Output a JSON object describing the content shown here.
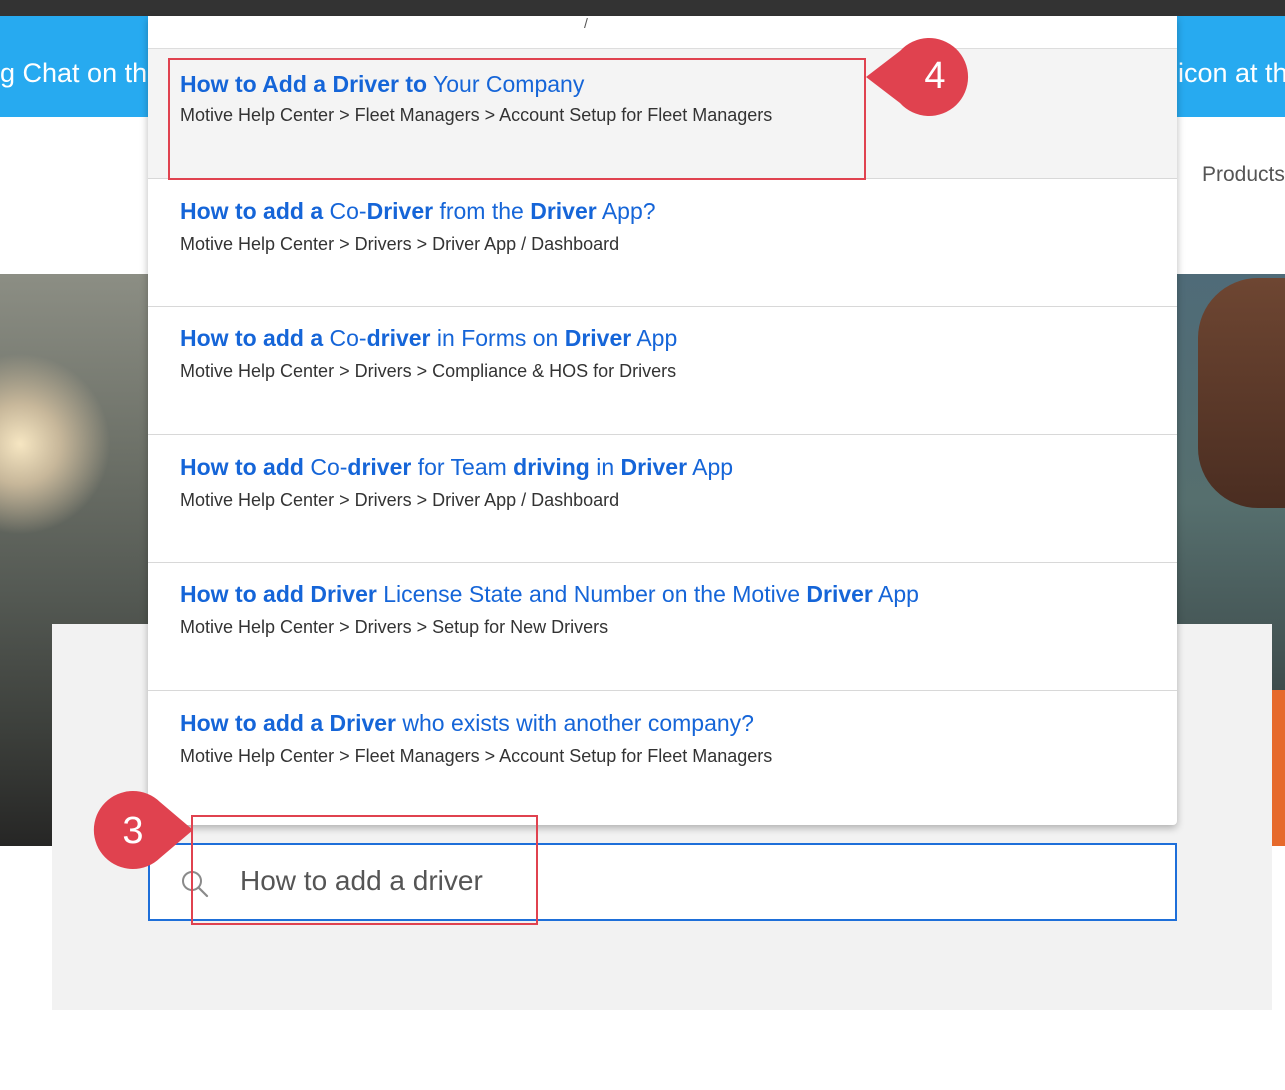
{
  "banner": {
    "left_text": "g Chat on the",
    "right_text": "icon at the"
  },
  "nav": {
    "products": "Products"
  },
  "dropdown": {
    "top_fragment": "/",
    "results": [
      {
        "title_parts": [
          {
            "t": "How to Add a Driver to",
            "b": true
          },
          {
            "t": " Your Company",
            "b": false
          }
        ],
        "path": "Motive Help Center > Fleet Managers > Account Setup for Fleet Managers"
      },
      {
        "title_parts": [
          {
            "t": "How to add a",
            "b": true
          },
          {
            "t": " Co-",
            "b": false
          },
          {
            "t": "Driver",
            "b": true
          },
          {
            "t": " from the ",
            "b": false
          },
          {
            "t": "Driver",
            "b": true
          },
          {
            "t": " App?",
            "b": false
          }
        ],
        "path": "Motive Help Center > Drivers > Driver App / Dashboard"
      },
      {
        "title_parts": [
          {
            "t": "How to add a",
            "b": true
          },
          {
            "t": " Co-",
            "b": false
          },
          {
            "t": "driver",
            "b": true
          },
          {
            "t": " in Forms on ",
            "b": false
          },
          {
            "t": "Driver",
            "b": true
          },
          {
            "t": " App",
            "b": false
          }
        ],
        "path": "Motive Help Center > Drivers > Compliance & HOS for Drivers"
      },
      {
        "title_parts": [
          {
            "t": "How to add",
            "b": true
          },
          {
            "t": " Co-",
            "b": false
          },
          {
            "t": "driver",
            "b": true
          },
          {
            "t": " for Team ",
            "b": false
          },
          {
            "t": "driving",
            "b": true
          },
          {
            "t": " in ",
            "b": false
          },
          {
            "t": "Driver",
            "b": true
          },
          {
            "t": " App",
            "b": false
          }
        ],
        "path": "Motive Help Center > Drivers > Driver App / Dashboard"
      },
      {
        "title_parts": [
          {
            "t": "How to add",
            "b": true
          },
          {
            "t": " ",
            "b": false
          },
          {
            "t": "Driver",
            "b": true
          },
          {
            "t": " License State and Number on the Motive ",
            "b": false
          },
          {
            "t": "Driver",
            "b": true
          },
          {
            "t": " App",
            "b": false
          }
        ],
        "path": "Motive Help Center > Drivers > Setup for New Drivers"
      },
      {
        "title_parts": [
          {
            "t": "How to add a",
            "b": true
          },
          {
            "t": " ",
            "b": false
          },
          {
            "t": "Driver",
            "b": true
          },
          {
            "t": " who exists with another company?",
            "b": false
          }
        ],
        "path": "Motive Help Center > Fleet Managers > Account Setup for Fleet Managers"
      }
    ]
  },
  "search": {
    "value": "How to add a driver",
    "icon": "search-icon"
  },
  "callouts": {
    "step3": "3",
    "step4": "4"
  },
  "colors": {
    "accent": "#1565d8",
    "banner": "#27aaf0",
    "callout": "#e0424f",
    "search_border": "#1e6fd9"
  }
}
